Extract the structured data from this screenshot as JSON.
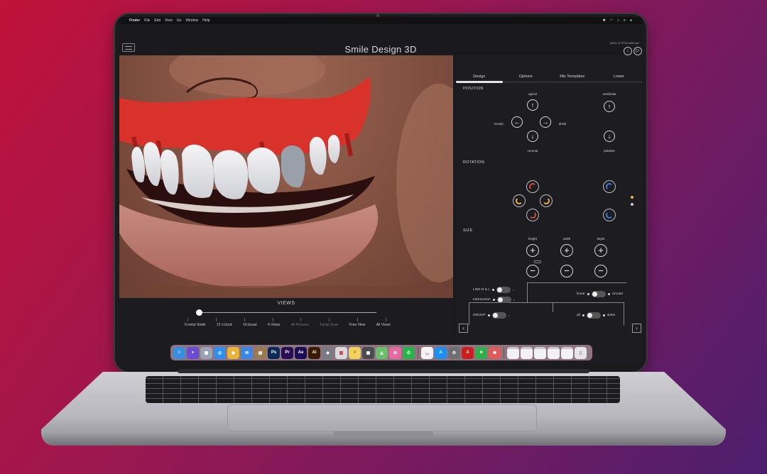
{
  "menubar": {
    "items": [
      "Finder",
      "File",
      "Edit",
      "View",
      "Go",
      "Window",
      "Help"
    ],
    "status_icons": [
      "bluetooth-icon",
      "wifi-icon",
      "search-icon",
      "control-center-icon",
      "siri-icon"
    ]
  },
  "app": {
    "title": "Smile Design 3D",
    "top_right_text": "SNOU LE RTNX 6MB mini"
  },
  "panel": {
    "tabs": [
      {
        "label": "Design",
        "active": true
      },
      {
        "label": "Options",
        "active": false
      },
      {
        "label": "Mix Templates",
        "active": false
      },
      {
        "label": "Lower",
        "active": false
      }
    ],
    "position": {
      "title": "POSITION",
      "apical": "apical",
      "mesial": "mesial",
      "distal": "distal",
      "coronal": "coronal",
      "vestibular": "vestibular",
      "palatine": "palatine"
    },
    "rotation": {
      "title": "ROTATION",
      "accent_colors": [
        "#d4483a",
        "#f0b24a",
        "#3b7bd6"
      ]
    },
    "size": {
      "title": "SIZE",
      "height": "height",
      "width": "width",
      "depth": "depth"
    },
    "toggles": {
      "link_rl": "LINK R & L",
      "intersection": "Intersection",
      "group": "GROUP",
      "linear": "linear",
      "circular": "circular",
      "all": "all",
      "sides": "sides",
      "off_mark": "n"
    },
    "indicator_colors": [
      "#f0b24a",
      "#c8c8cc"
    ]
  },
  "views": {
    "title": "VIEWS",
    "slider_fraction": 0,
    "options": [
      {
        "label": "Frontal Smile",
        "enabled": true
      },
      {
        "label": "12 o'clock",
        "enabled": true
      },
      {
        "label": "Occlusal",
        "enabled": true
      },
      {
        "label": "4 Views",
        "enabled": true
      },
      {
        "label": "All Pictures",
        "enabled": false
      },
      {
        "label": "Facial Scan",
        "enabled": false
      },
      {
        "label": "Free View",
        "enabled": true
      },
      {
        "label": "All Views",
        "enabled": true
      }
    ]
  },
  "dock": {
    "apps": [
      {
        "name": "finder-icon",
        "glyph": "☺",
        "color": "#3c8de0"
      },
      {
        "name": "siri-icon",
        "glyph": "●",
        "color": "#6a4bd6"
      },
      {
        "name": "launchpad-icon",
        "glyph": "▦",
        "color": "#9aa3b5"
      },
      {
        "name": "safari-icon",
        "glyph": "◎",
        "color": "#2e8ff0"
      },
      {
        "name": "chrome-icon",
        "glyph": "◉",
        "color": "#e8b53a"
      },
      {
        "name": "mail-icon",
        "glyph": "✉",
        "color": "#3a86e8"
      },
      {
        "name": "notes-app-icon",
        "glyph": "▤",
        "color": "#9a7a50"
      },
      {
        "name": "photoshop-icon",
        "glyph": "Ps",
        "color": "#0a2a55"
      },
      {
        "name": "premiere-icon",
        "glyph": "Pr",
        "color": "#2a0d55"
      },
      {
        "name": "after-effects-icon",
        "glyph": "Ae",
        "color": "#1b0d55"
      },
      {
        "name": "illustrator-icon",
        "glyph": "Ai",
        "color": "#3a1a05"
      },
      {
        "name": "keynote-icon",
        "glyph": "◆",
        "color": "#7a7a85"
      },
      {
        "name": "preview-icon",
        "glyph": "▥",
        "color": "#d9d9de"
      },
      {
        "name": "notes-icon",
        "glyph": "≡",
        "color": "#f0d35a"
      },
      {
        "name": "calculator-icon",
        "glyph": "▦",
        "color": "#4a4a50"
      },
      {
        "name": "maps-icon",
        "glyph": "◭",
        "color": "#6ac06a"
      },
      {
        "name": "photos-icon",
        "glyph": "✿",
        "color": "#e46aa0"
      },
      {
        "name": "whatsapp-icon",
        "glyph": "✆",
        "color": "#25b34a"
      },
      {
        "name": "smile-design-icon",
        "glyph": "◡",
        "color": "#f4f4f4"
      },
      {
        "name": "app-store-icon",
        "glyph": "A",
        "color": "#1e8ff0"
      },
      {
        "name": "system-preferences-icon",
        "glyph": "⚙",
        "color": "#6e6e75"
      },
      {
        "name": "acrobat-icon",
        "glyph": "A",
        "color": "#c82020"
      },
      {
        "name": "facetime-icon",
        "glyph": "■",
        "color": "#2fb14a"
      },
      {
        "name": "photo-booth-icon",
        "glyph": "✺",
        "color": "#e05a5a"
      }
    ],
    "folders": [
      "folder-icon",
      "folder-icon",
      "folder-icon",
      "folder-icon",
      "folder-icon"
    ],
    "trash": "trash-icon"
  }
}
